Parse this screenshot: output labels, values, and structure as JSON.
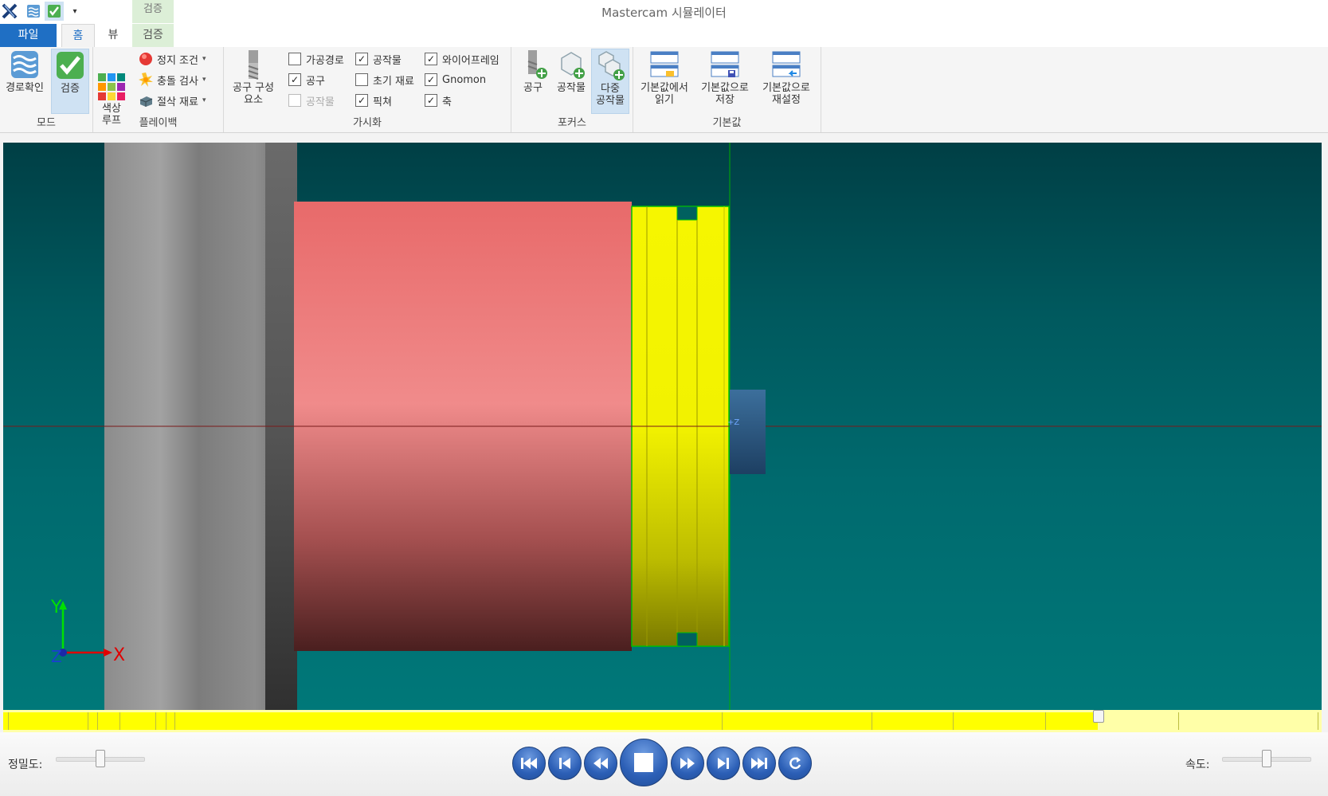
{
  "app": {
    "title": "Mastercam 시뮬레이터"
  },
  "context_tab_header": "검증",
  "tabs": {
    "file": "파일",
    "home": "홈",
    "view": "뷰",
    "verify": "검증"
  },
  "ribbon": {
    "mode": {
      "label": "모드",
      "path_check": "경로확인",
      "verify": "검증"
    },
    "playback": {
      "label": "플레이백",
      "color_loop": "색상\n루프",
      "stop_condition": "정지 조건",
      "collision_check": "충돌 검사",
      "cut_stock": "절삭 재료"
    },
    "visibility": {
      "label": "가시화",
      "tool_component": "공구 구성\n요소",
      "checkboxes": [
        {
          "label": "가공경로",
          "checked": false,
          "enabled": true
        },
        {
          "label": "공구",
          "checked": true,
          "enabled": true
        },
        {
          "label": "공작물",
          "checked": false,
          "enabled": false
        },
        {
          "label": "공작물",
          "checked": true,
          "enabled": true
        },
        {
          "label": "초기 재료",
          "checked": false,
          "enabled": true
        },
        {
          "label": "픽쳐",
          "checked": true,
          "enabled": true
        },
        {
          "label": "와이어프레임",
          "checked": true,
          "enabled": true
        },
        {
          "label": "Gnomon",
          "checked": true,
          "enabled": true
        },
        {
          "label": "축",
          "checked": true,
          "enabled": true
        }
      ]
    },
    "focus": {
      "label": "포커스",
      "tool": "공구",
      "workpiece": "공작물",
      "multi_workpiece": "다중\n공작물"
    },
    "defaults": {
      "label": "기본값",
      "load": "기본값에서\n읽기",
      "save": "기본값으로\n저장",
      "reset": "기본값으로\n재설정"
    }
  },
  "viewport": {
    "background_top": "#003f45",
    "background_bottom": "#007879",
    "gnomon": {
      "x": "X",
      "y": "Y",
      "z": "Z"
    },
    "z_marker": "+Z"
  },
  "timeline": {
    "progress": 0.83,
    "fill_color": "#ffff00"
  },
  "controls": {
    "precision_label": "정밀도:",
    "precision_value": 0.5,
    "speed_label": "속도:",
    "speed_value": 0.5,
    "buttons": [
      "first-icon",
      "step-back-icon",
      "rewind-icon",
      "stop-icon",
      "forward-icon",
      "step-forward-icon",
      "last-icon",
      "loop-icon"
    ]
  }
}
